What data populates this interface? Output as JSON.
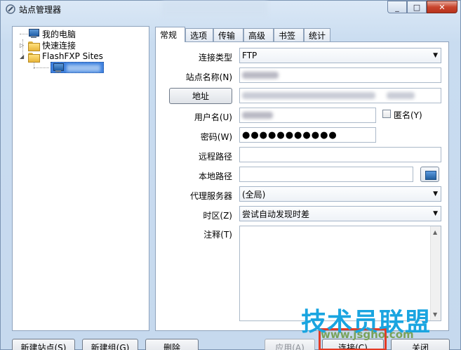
{
  "window": {
    "title": "站点管理器",
    "min_icon": "_",
    "max_icon": "□",
    "close_icon": "✕"
  },
  "tree": {
    "items": [
      {
        "label": "我的电脑",
        "icon": "computer-icon"
      },
      {
        "label": "快速连接",
        "icon": "folder-icon"
      },
      {
        "label": "FlashFXP Sites",
        "icon": "folder-icon"
      }
    ]
  },
  "tabs": [
    "常规",
    "选项",
    "传输",
    "高级",
    "书签",
    "统计"
  ],
  "form": {
    "connect_type_label": "连接类型",
    "connect_type_value": "FTP",
    "site_name_label": "站点名称(N)",
    "address_button": "地址",
    "username_label": "用户名(U)",
    "anonymous_label": "匿名(Y)",
    "password_label": "密码(W)",
    "password_value": "●●●●●●●●●●●",
    "remote_path_label": "远程路径",
    "local_path_label": "本地路径",
    "proxy_label": "代理服务器",
    "proxy_value": "(全局)",
    "timezone_label": "时区(Z)",
    "timezone_value": "尝试自动发现时差",
    "notes_label": "注释(T)"
  },
  "buttons": {
    "new_site": "新建站点(S)",
    "new_group": "新建组(G)",
    "delete": "删除",
    "apply": "应用(A)",
    "connect": "连接(C)",
    "close": "关闭"
  },
  "watermark": {
    "text": "技术员联盟",
    "url": "www.jsgho.com"
  },
  "colors": {
    "selection": "#3d80df",
    "watermark": "#1aa5e0",
    "highlight_box": "#e43a25"
  }
}
